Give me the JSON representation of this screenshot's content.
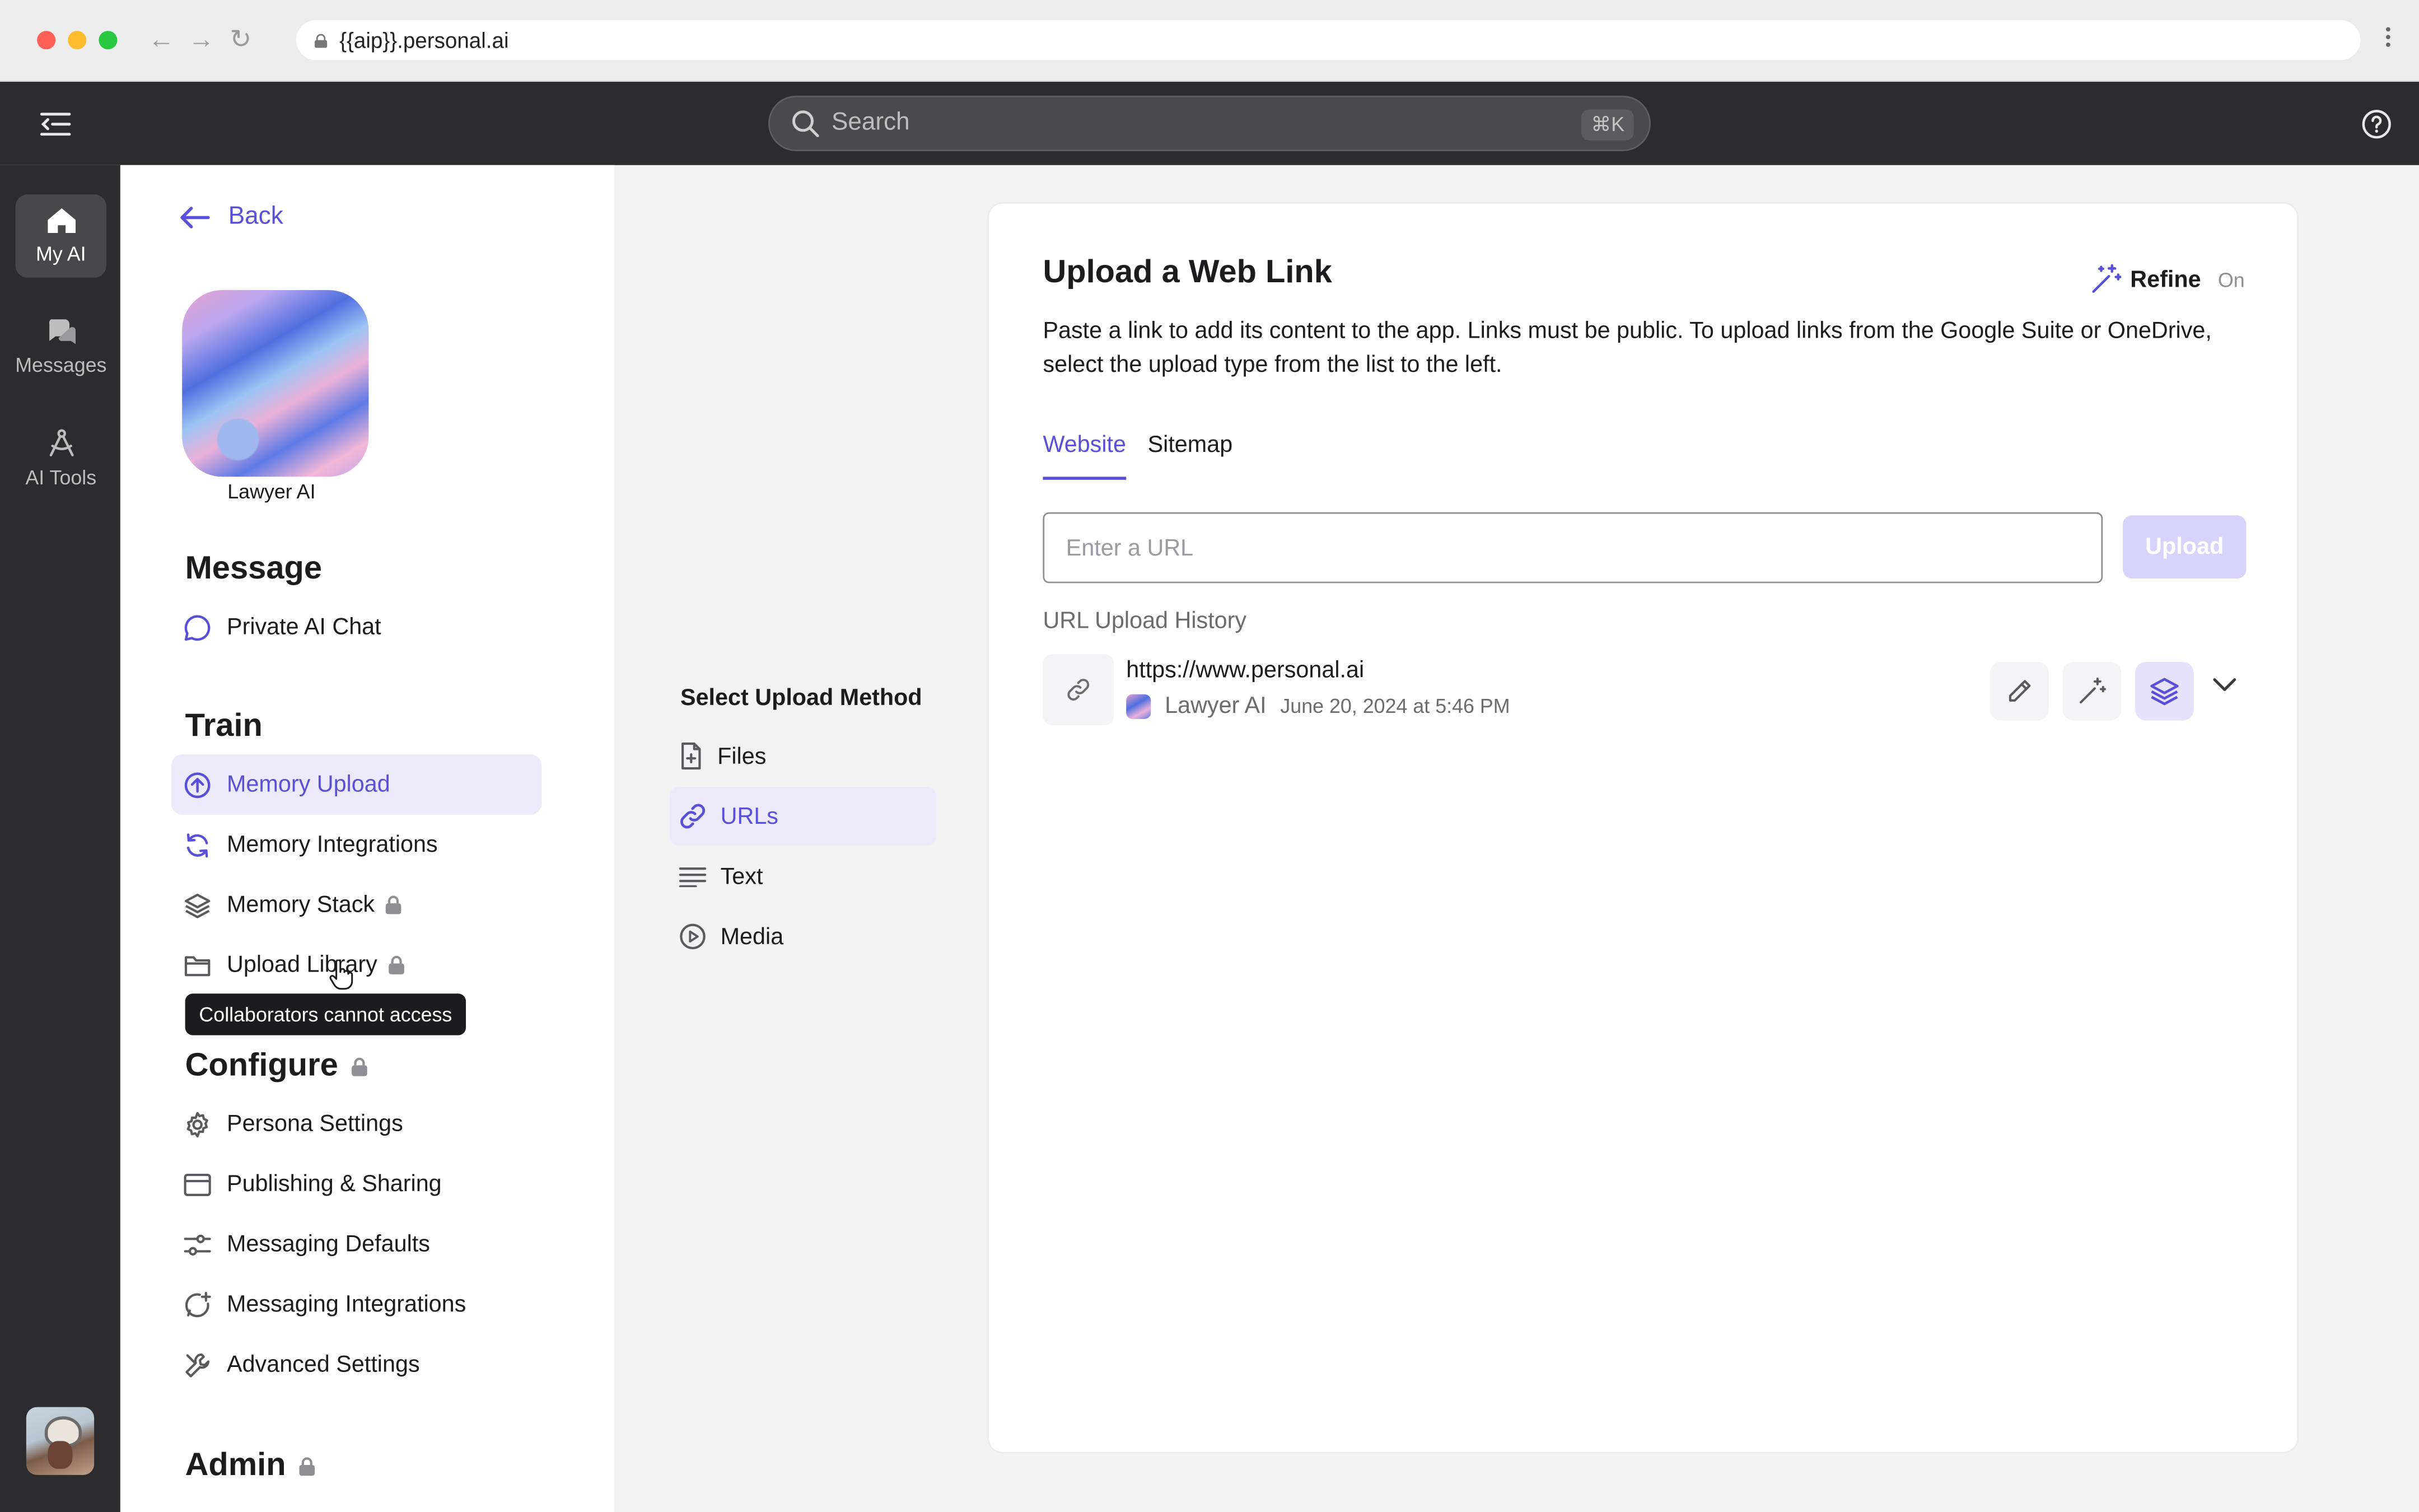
{
  "browser": {
    "url": "{{aip}}.personal.ai"
  },
  "topbar": {
    "search_placeholder": "Search",
    "shortcut": "⌘K"
  },
  "rail": {
    "items": [
      {
        "label": "My AI",
        "active": true
      },
      {
        "label": "Messages",
        "active": false
      },
      {
        "label": "AI Tools",
        "active": false
      }
    ]
  },
  "settings": {
    "back": "Back",
    "ai_name": "Lawyer AI",
    "sections": {
      "message": "Message",
      "train": "Train",
      "configure": "Configure",
      "admin": "Admin"
    },
    "message_items": [
      "Private AI Chat"
    ],
    "train_items": [
      "Memory Upload",
      "Memory Integrations",
      "Memory Stack",
      "Upload Library"
    ],
    "configure_items": [
      "Persona Settings",
      "Publishing & Sharing",
      "Messaging Defaults",
      "Messaging Integrations",
      "Advanced Settings"
    ],
    "tooltip": "Collaborators cannot access"
  },
  "methods": {
    "title": "Select Upload Method",
    "items": [
      "Files",
      "URLs",
      "Text",
      "Media"
    ],
    "active": "URLs"
  },
  "card": {
    "title": "Upload a Web Link",
    "refine_label": "Refine",
    "refine_state": "On",
    "description": "Paste a link to add its content to the app. Links must be public. To upload links from the Google Suite or OneDrive, select the upload type from the list to the left.",
    "tabs": [
      "Website",
      "Sitemap"
    ],
    "active_tab": "Website",
    "url_placeholder": "Enter a URL",
    "upload_label": "Upload",
    "history_label": "URL Upload History",
    "history": [
      {
        "url": "https://www.personal.ai",
        "owner": "Lawyer AI",
        "date": "June 20, 2024 at 5:46 PM"
      }
    ]
  },
  "colors": {
    "accent": "#5a4fd8",
    "accent_light": "#ece9fb",
    "dark": "#2c2c2e"
  }
}
